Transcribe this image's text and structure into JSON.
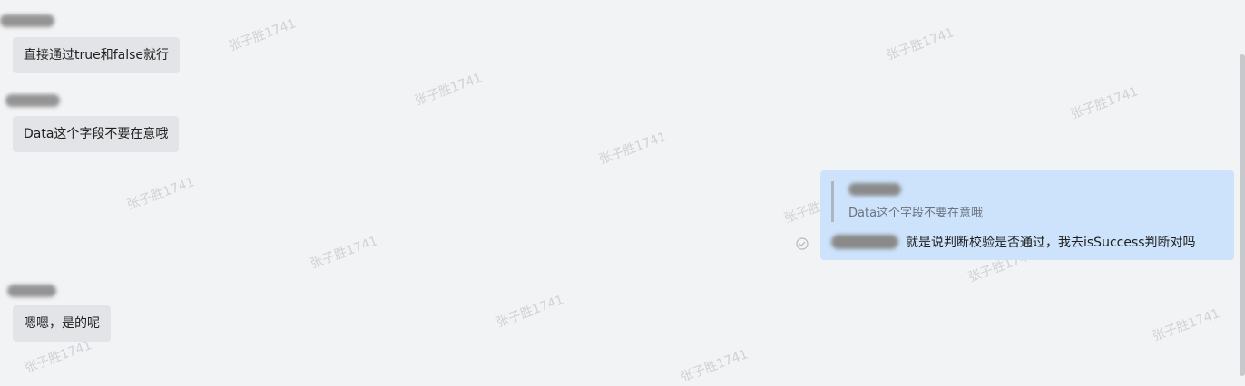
{
  "messages": [
    {
      "text": "直接通过true和false就行"
    },
    {
      "text": "Data这个字段不要在意哦"
    },
    {
      "text": "嗯嗯，是的呢"
    }
  ],
  "reply": {
    "quoted_text": "Data这个字段不要在意哦",
    "text": "就是说判断校验是否通过，我去isSuccess判断对吗"
  },
  "watermark": "张子胜1741"
}
